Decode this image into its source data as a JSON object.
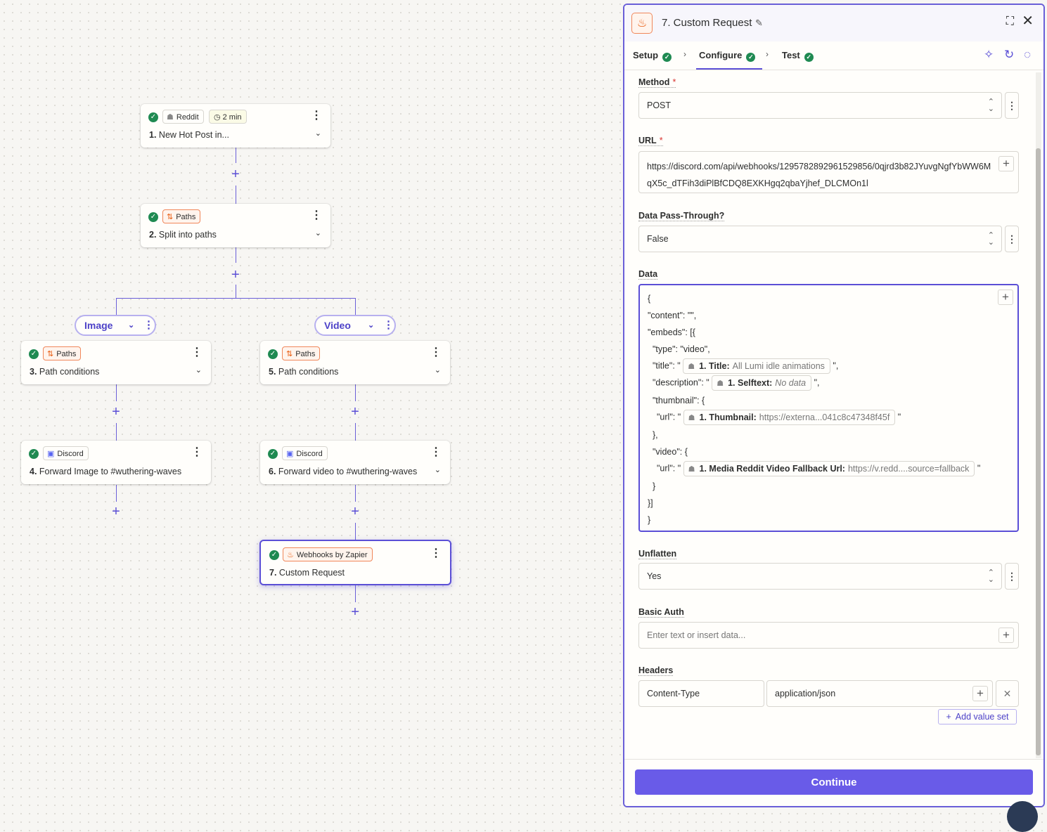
{
  "canvas": {
    "nodes": [
      {
        "id": "1",
        "app": "Reddit",
        "app_icon": "reddit-icon",
        "badge_extra": "2 min",
        "num": "1.",
        "title": "New Hot Post in..."
      },
      {
        "id": "2",
        "app": "Paths",
        "app_icon": "paths-icon",
        "num": "2.",
        "title": "Split into paths"
      },
      {
        "id": "3",
        "app": "Paths",
        "app_icon": "paths-icon",
        "num": "3.",
        "title": "Path conditions"
      },
      {
        "id": "4",
        "app": "Discord",
        "app_icon": "discord-icon",
        "num": "4.",
        "title": "Forward Image to #wuthering-waves"
      },
      {
        "id": "5",
        "app": "Paths",
        "app_icon": "paths-icon",
        "num": "5.",
        "title": "Path conditions"
      },
      {
        "id": "6",
        "app": "Discord",
        "app_icon": "discord-icon",
        "num": "6.",
        "title": "Forward video to #wuthering-waves"
      },
      {
        "id": "7",
        "app": "Webhooks by Zapier",
        "app_icon": "webhook-icon",
        "num": "7.",
        "title": "Custom Request"
      }
    ],
    "paths": [
      "Image",
      "Video"
    ]
  },
  "panel": {
    "title": "7. Custom Request",
    "tabs": [
      "Setup",
      "Configure",
      "Test"
    ],
    "active_tab": "Configure",
    "fields": {
      "method": {
        "label": "Method",
        "value": "POST"
      },
      "url": {
        "label": "URL",
        "value": "https://discord.com/api/webhooks/1295782892961529856/0qjrd3b82JYuvgNgfYbWW6MqX5c_dTFih3diPlBfCDQ8EXKHgq2qbaYjhef_DLCMOn1l"
      },
      "passthrough": {
        "label": "Data Pass-Through?",
        "value": "False"
      },
      "data": {
        "label": "Data",
        "l1": "{",
        "l2": "\"content\": \"\",",
        "l3": "\"embeds\": [{",
        "l4": "\"type\": \"video\",",
        "l5_pre": "\"title\": \"",
        "l5_pill_label": "1. Title:",
        "l5_pill_value": "All Lumi idle animations",
        "l5_post": "\",",
        "l6_pre": "\"description\": \"",
        "l6_pill_label": "1. Selftext:",
        "l6_pill_value": "No data",
        "l6_post": "\",",
        "l7": "\"thumbnail\": {",
        "l8_pre": "\"url\": \"",
        "l8_pill_label": "1. Thumbnail:",
        "l8_pill_value": "https://externa...041c8c47348f45f",
        "l8_post": "\"",
        "l9": "},",
        "l10": "\"video\": {",
        "l11_pre": "\"url\": \"",
        "l11_pill_label": "1. Media Reddit Video Fallback Url:",
        "l11_pill_value": "https://v.redd....source=fallback",
        "l11_post": "\"",
        "l12": "}",
        "l13": "}]",
        "l14": "}"
      },
      "unflatten": {
        "label": "Unflatten",
        "value": "Yes"
      },
      "basic_auth": {
        "label": "Basic Auth",
        "placeholder": "Enter text or insert data..."
      },
      "headers": {
        "label": "Headers",
        "key": "Content-Type",
        "value": "application/json",
        "add_label": "Add value set"
      }
    },
    "continue_label": "Continue"
  },
  "colors": {
    "accent": "#695be8",
    "success": "#1f8a52",
    "webhook": "#e8590c"
  }
}
